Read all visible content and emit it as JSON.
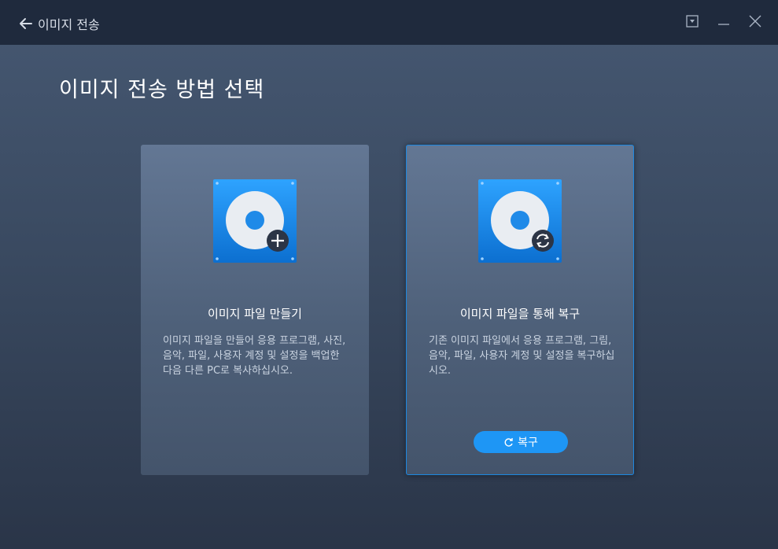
{
  "window": {
    "title": "이미지 전송"
  },
  "page": {
    "title": "이미지 전송 방법 선택"
  },
  "cards": [
    {
      "title": "이미지 파일 만들기",
      "description": "이미지 파일을 만들어 응용 프로그램, 사진, 음악, 파일, 사용자 계정 및 설정을 백업한 다음 다른 PC로 복사하십시오.",
      "icon": "disk-plus-icon"
    },
    {
      "title": "이미지 파일을 통해 복구",
      "description": "기존 이미지 파일에서 응용 프로그램, 그림, 음악, 파일, 사용자 계정 및 설정을 복구하십시오.",
      "icon": "disk-restore-icon",
      "button_label": "복구"
    }
  ],
  "colors": {
    "accent": "#1e96f5",
    "titlebar": "#1f2a3d"
  }
}
